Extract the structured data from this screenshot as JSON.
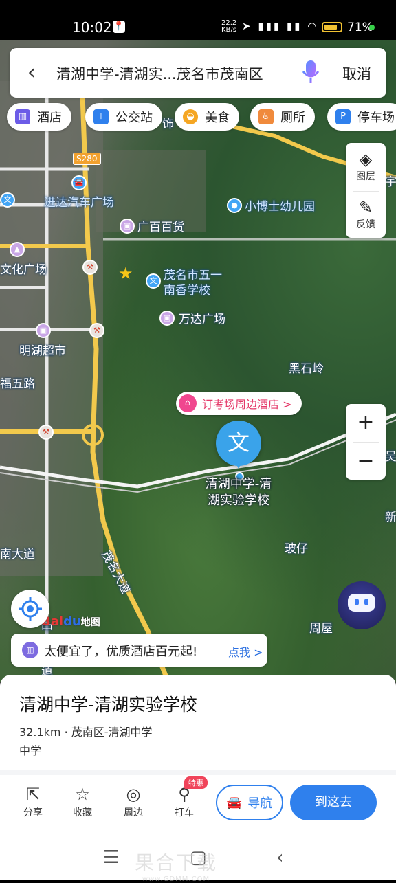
{
  "status_bar": {
    "time": "10:02",
    "net_speed_value": "22.2",
    "net_speed_unit": "KB/s",
    "battery": "71%"
  },
  "search": {
    "query": "清湖中学-清湖实...茂名市茂南区",
    "cancel": "取消"
  },
  "chips": [
    {
      "label": "酒店",
      "icon": "hotel-icon",
      "color": "#6c5ce7"
    },
    {
      "label": "公交站",
      "icon": "bus-stop-icon",
      "color": "#2f80ed"
    },
    {
      "label": "美食",
      "icon": "food-icon",
      "color": "#f5a623"
    },
    {
      "label": "厕所",
      "icon": "toilet-icon",
      "color": "#f08a3c"
    },
    {
      "label": "停车场",
      "icon": "parking-icon",
      "color": "#2f80ed"
    }
  ],
  "map_controls": {
    "layers": "图层",
    "feedback": "反馈",
    "zoom_in": "+",
    "zoom_out": "−"
  },
  "map_labels": {
    "road_s280": "S280",
    "jinda": "进达汽车广场",
    "xiaoboshi": "小博士幼儿园",
    "guangbai": "广百百货",
    "wuyi_school": "茂名市五一\n南香学校",
    "wanda": "万达广场",
    "culture_square": "文化广场",
    "minghu": "明湖超市",
    "fuwu_road": "福五路",
    "heishiling": "黑石岭",
    "nan_road": "南大道",
    "maoming_road": "茂名大道",
    "poze": "玻仔",
    "zhouwu": "周屋",
    "zhong": "中",
    "dao": "道",
    "right_edge_1": "宇",
    "right_edge_2": "吴",
    "right_edge_3": "新",
    "top_shi": "饰"
  },
  "hotel_tip": "订考场周边酒店 >",
  "destination": {
    "pin_glyph": "文",
    "label": "清湖中学-清湖实验学校"
  },
  "baidu_logo": {
    "bai": "Bai",
    "du": "du",
    "map": "地图"
  },
  "promo": {
    "text": "太便宜了，优质酒店百元起!",
    "link": "点我 >"
  },
  "place": {
    "title": "清湖中学-清湖实验学校",
    "meta": "32.1km · 茂南区-清湖中学",
    "category": "中学"
  },
  "actions": [
    {
      "label": "分享",
      "icon": "share-icon"
    },
    {
      "label": "收藏",
      "icon": "star-icon"
    },
    {
      "label": "周边",
      "icon": "compass-icon"
    },
    {
      "label": "打车",
      "icon": "taxi-icon"
    }
  ],
  "taxi_tag": "特惠",
  "buttons": {
    "navigate": "导航",
    "go_here": "到这去"
  },
  "watermark": {
    "main": "果合下载",
    "sub": "www.GDMM.COM"
  }
}
